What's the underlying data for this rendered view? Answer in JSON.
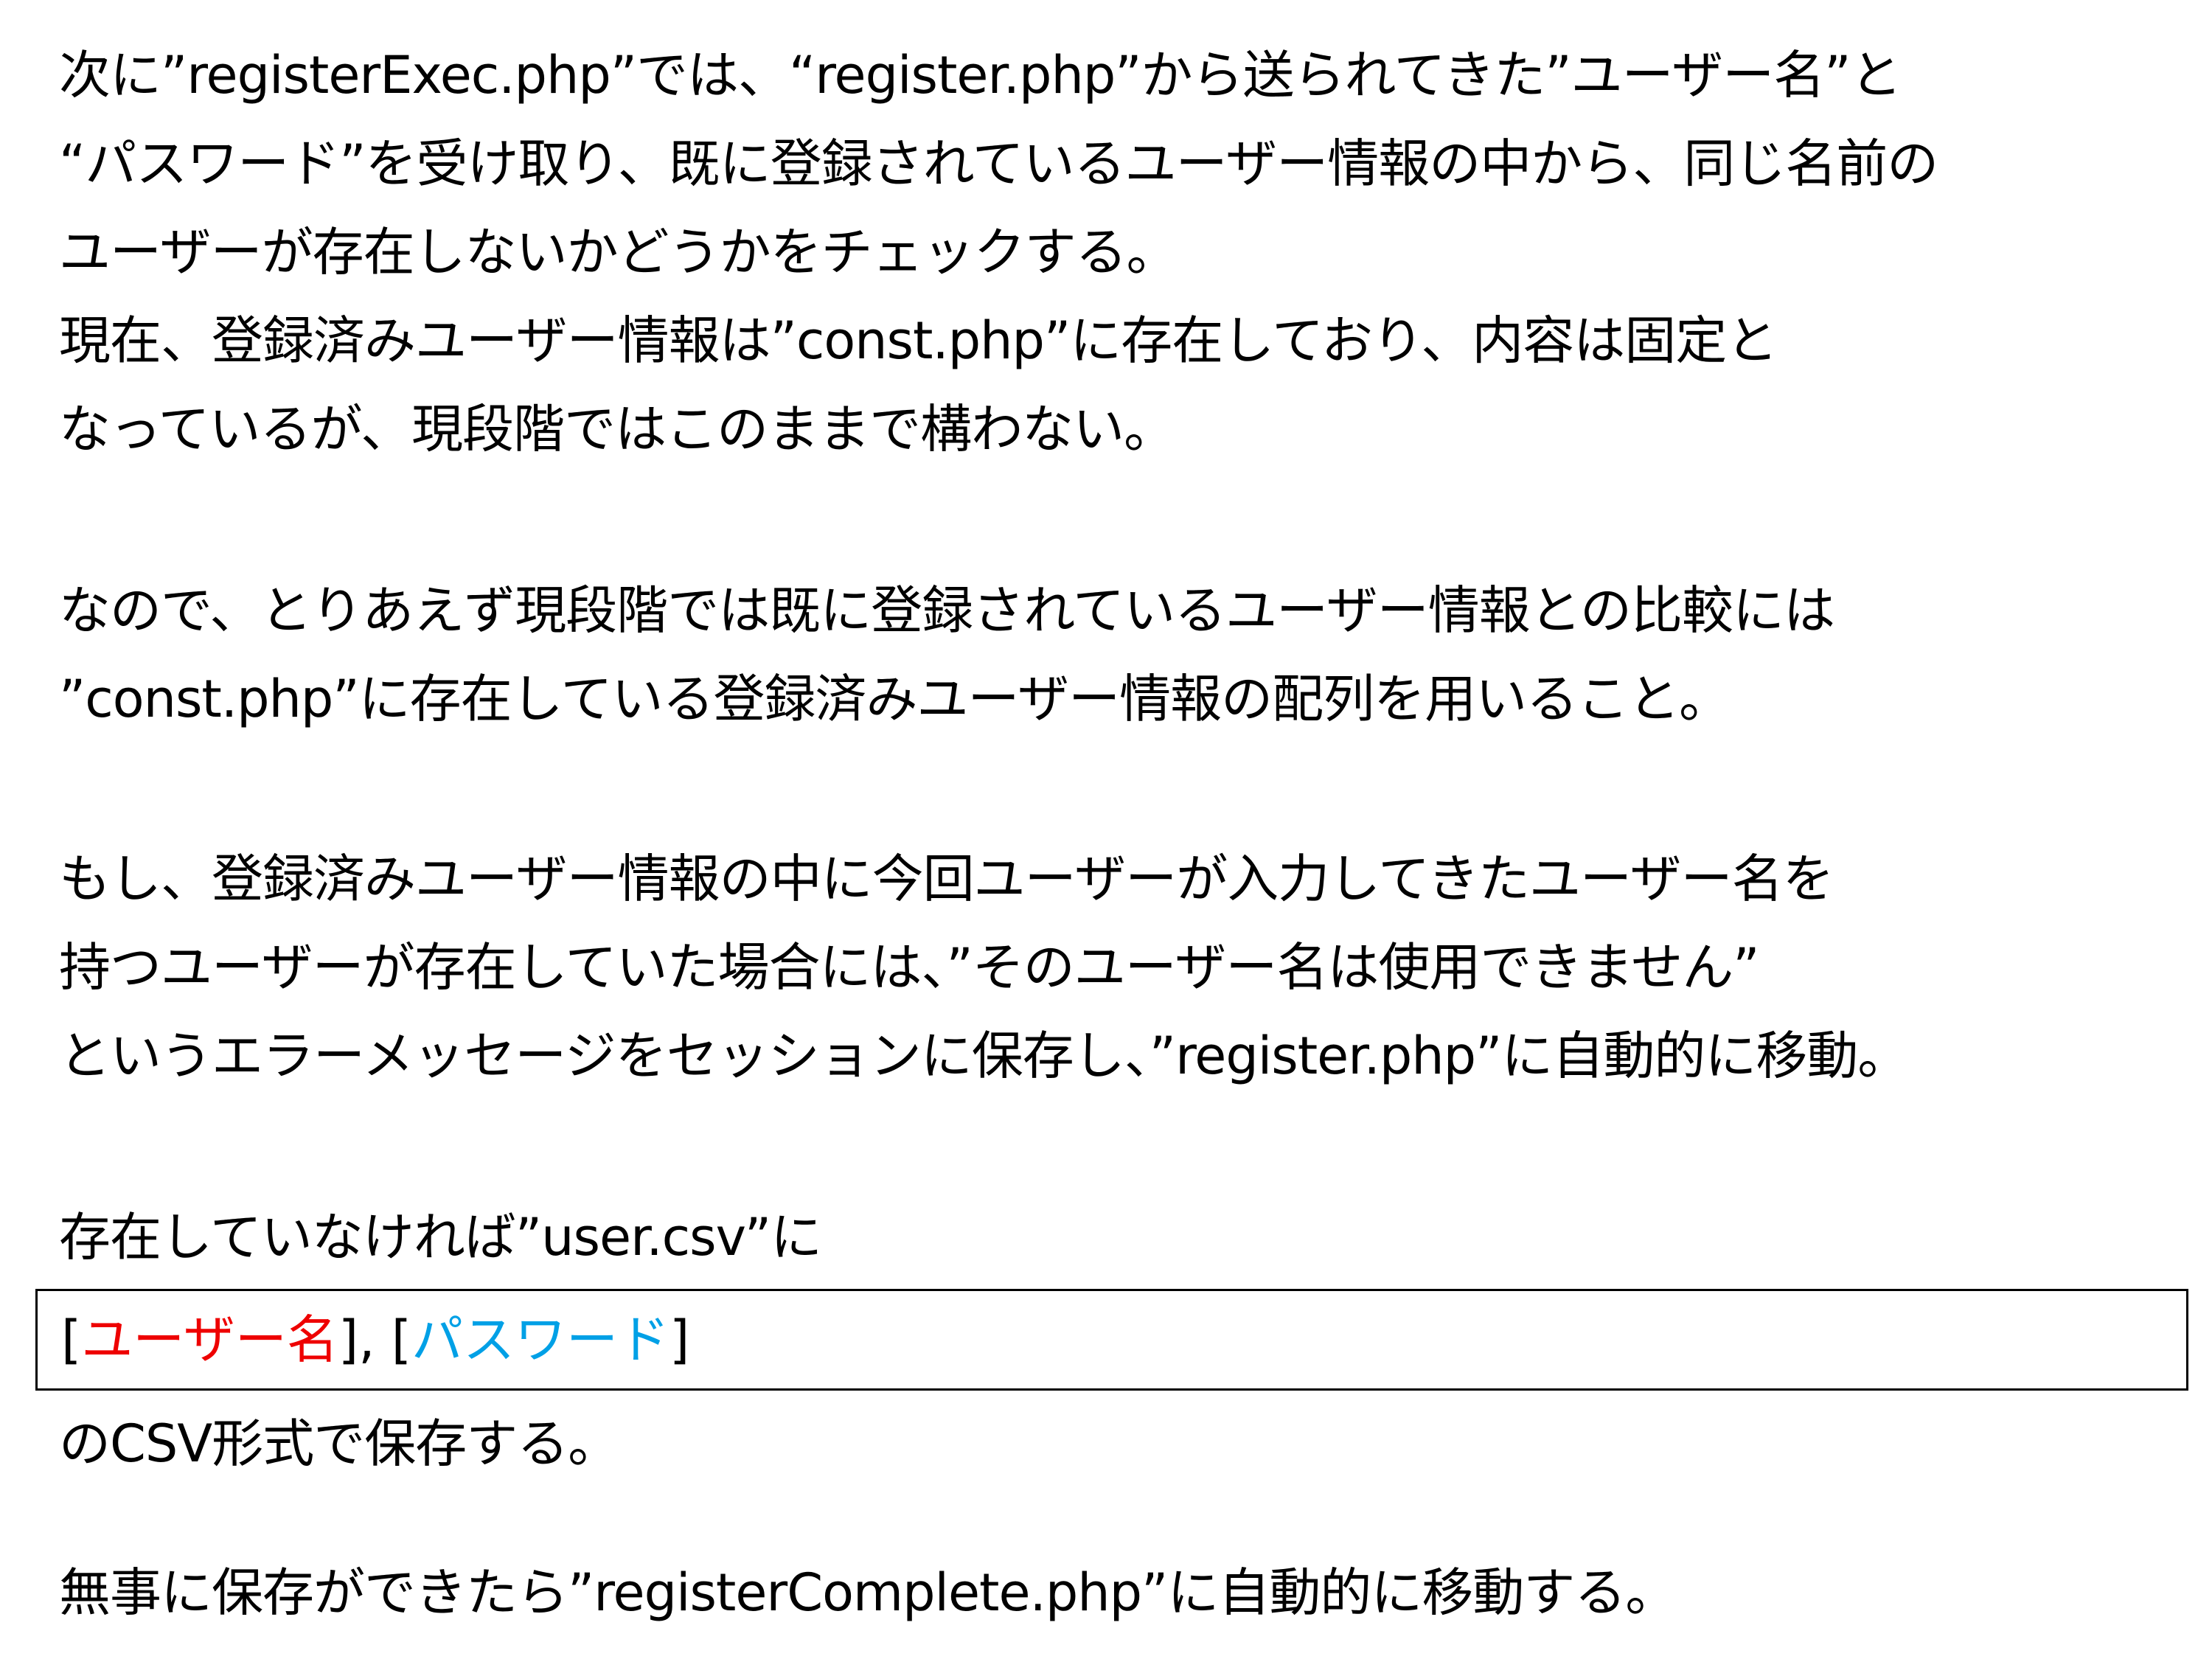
{
  "paragraphs": {
    "p1": [
      "次に”registerExec.php”では、“register.php”から送られてきた”ユーザー名”と",
      "“パスワード”を受け取り、既に登録されているユーザー情報の中から、同じ名前の",
      "ユーザーが存在しないかどうかをチェックする。",
      "現在、登録済みユーザー情報は”const.php”に存在しており、内容は固定と",
      "なっているが、現段階ではこのままで構わない。"
    ],
    "p2": [
      "なので、とりあえず現段階では既に登録されているユーザー情報との比較には",
      "”const.php”に存在している登録済みユーザー情報の配列を用いること。"
    ],
    "p3": [
      "もし、登録済みユーザー情報の中に今回ユーザーが入力してきたユーザー名を",
      "持つユーザーが存在していた場合には、”そのユーザー名は使用できません”",
      "というエラーメッセージをセッションに保存し、”register.php”に自動的に移動。"
    ],
    "p4_intro": "存在していなければ”user.csv”に",
    "csv_example": {
      "open1": "[",
      "field1": "ユーザー名",
      "close1_sep": "], [",
      "field2": "パスワード",
      "close2": "]",
      "field1_color": "#ee0000",
      "field2_color": "#00a0e6"
    },
    "p4_outro": "のCSV形式で保存する。",
    "p5": "無事に保存ができたら”registerComplete.php”に自動的に移動する。"
  }
}
